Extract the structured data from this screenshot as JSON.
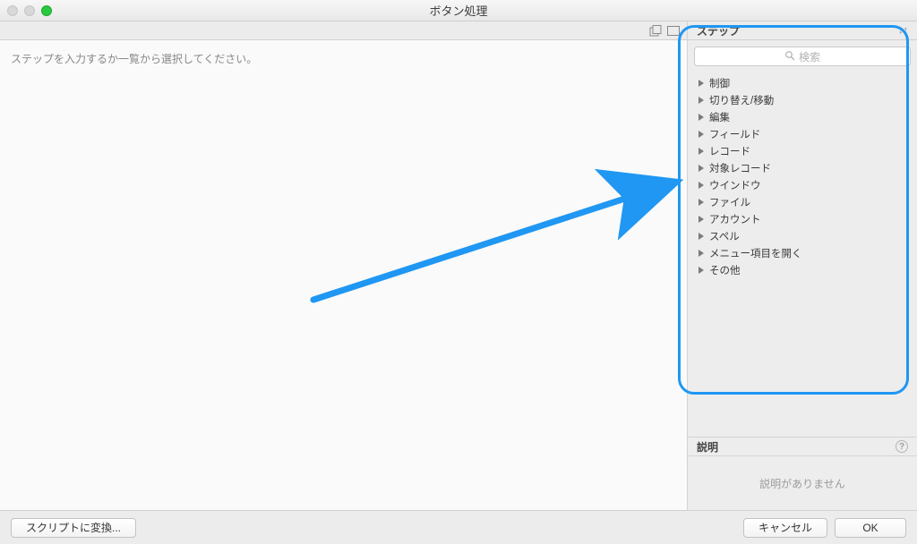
{
  "window": {
    "title": "ボタン処理"
  },
  "left": {
    "placeholder": "ステップを入力するか一覧から選択してください。"
  },
  "side": {
    "steps_header": "ステップ",
    "search_placeholder": "検索",
    "categories": [
      "制御",
      "切り替え/移動",
      "編集",
      "フィールド",
      "レコード",
      "対象レコード",
      "ウインドウ",
      "ファイル",
      "アカウント",
      "スペル",
      "メニュー項目を開く",
      "その他"
    ]
  },
  "desc": {
    "header": "説明",
    "empty_text": "説明がありません"
  },
  "footer": {
    "convert_label": "スクリプトに変換...",
    "cancel_label": "キャンセル",
    "ok_label": "OK"
  }
}
